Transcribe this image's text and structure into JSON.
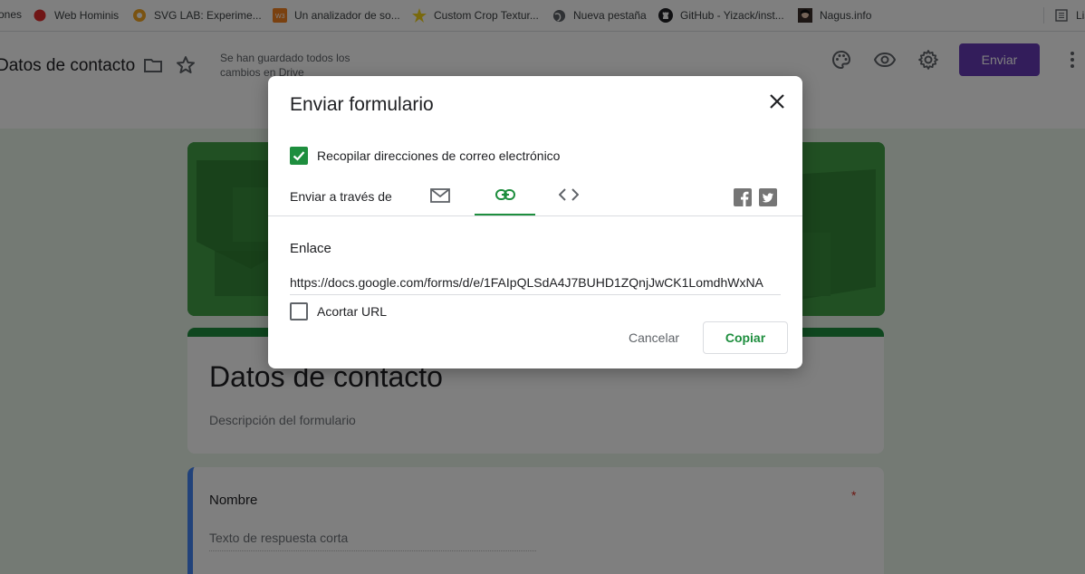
{
  "bookmarks": [
    {
      "label": "ones",
      "icon": "none"
    },
    {
      "label": "Web Hominis",
      "icon": "red-dot-icon"
    },
    {
      "label": "SVG LAB: Experime...",
      "icon": "flower-icon"
    },
    {
      "label": "Un analizador de so...",
      "icon": "w3-icon"
    },
    {
      "label": "Custom Crop Textur...",
      "icon": "star-burst-icon"
    },
    {
      "label": "Nueva pestaña",
      "icon": "globe-icon"
    },
    {
      "label": "GitHub - Yizack/inst...",
      "icon": "github-icon"
    },
    {
      "label": "Nagus.info",
      "icon": "avatar-icon"
    },
    {
      "label": "Lis",
      "icon": "reading-list-icon"
    }
  ],
  "header": {
    "doc_title": "Datos de contacto",
    "saved_status": "Se han guardado todos los cambios en Drive",
    "send_label": "Enviar"
  },
  "form": {
    "title": "Datos de contacto",
    "description": "Descripción del formulario",
    "question": {
      "label": "Nombre",
      "required_mark": "*",
      "placeholder": "Texto de respuesta corta"
    }
  },
  "dialog": {
    "title": "Enviar formulario",
    "collect_emails_label": "Recopilar direcciones de correo electrónico",
    "collect_emails_checked": true,
    "send_via_label": "Enviar a través de",
    "tabs": [
      {
        "name": "email",
        "icon": "mail-icon",
        "active": false
      },
      {
        "name": "link",
        "icon": "link-icon",
        "active": true
      },
      {
        "name": "embed",
        "icon": "code-icon",
        "active": false
      }
    ],
    "section_label": "Enlace",
    "link_value": "https://docs.google.com/forms/d/e/1FAIpQLSdA4J7BUHD1ZQnjJwCK1LomdhWxNA",
    "shorten_label": "Acortar URL",
    "shorten_checked": false,
    "cancel_label": "Cancelar",
    "copy_label": "Copiar"
  },
  "colors": {
    "accent_purple": "#673ab7",
    "accent_green": "#1e8e3e",
    "question_blue": "#4285f4"
  }
}
